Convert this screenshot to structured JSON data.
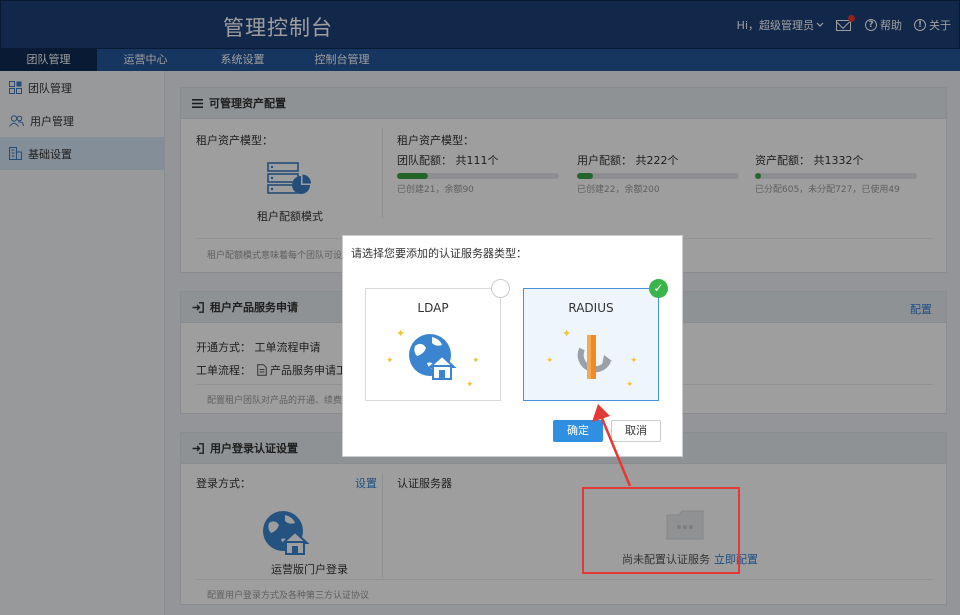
{
  "header": {
    "title": "管理控制台",
    "greeting": "Hi，超级管理员",
    "help": "帮助",
    "about": "关于",
    "colors": {
      "primary": "#1d4178",
      "nav": "#25569a",
      "active_tab": "#0f2a55"
    }
  },
  "nav": {
    "tabs": [
      {
        "label": "团队管理"
      },
      {
        "label": "运营中心"
      },
      {
        "label": "系统设置"
      },
      {
        "label": "控制台管理"
      }
    ]
  },
  "sidebar": {
    "items": [
      {
        "label": "团队管理",
        "icon": "grid-icon"
      },
      {
        "label": "用户管理",
        "icon": "users-icon"
      },
      {
        "label": "基础设置",
        "icon": "building-icon"
      }
    ]
  },
  "asset_panel": {
    "title": "可管理资产配置",
    "left_label": "租户资产模型：",
    "mode_label": "租户配额模式",
    "right_label": "租户资产模型：",
    "note": "租户配额模式意味着每个团队可设",
    "quotas": [
      {
        "label": "团队配额：   共111个",
        "sub": "已创建21，余额90",
        "fill": 0.19
      },
      {
        "label": "用户配额：   共222个",
        "sub": "已创建22，余额200",
        "fill": 0.1
      },
      {
        "label": "资产配额：   共1332个",
        "sub": "已分配605，未分配727，已使用49",
        "fill": 0.04
      }
    ]
  },
  "product_panel": {
    "title": "租户产品服务申请",
    "link": "配置",
    "open_mode": "开通方式：  工单流程申请",
    "flow_label": "工单流程：",
    "flow_value": "产品服务申请工",
    "note": "配置租户团队对产品的开通、续费"
  },
  "login_panel": {
    "title": "用户登录认证设置",
    "login_label": "登录方式：",
    "set_link": "设置",
    "auth_label": "认证服务器",
    "portal_label": "运营版门户登录",
    "empty_text": "尚未配置认证服务",
    "empty_link": "立即配置",
    "note": "配置用户登录方式及各种第三方认证协议"
  },
  "dialog": {
    "title": "请选择您要添加的认证服务器类型：",
    "options": [
      {
        "label": "LDAP",
        "selected": false
      },
      {
        "label": "RADIUS",
        "selected": true
      }
    ],
    "ok": "确定",
    "cancel": "取消",
    "check_mark": "✓"
  },
  "annotation": {
    "color": "#e53935"
  }
}
